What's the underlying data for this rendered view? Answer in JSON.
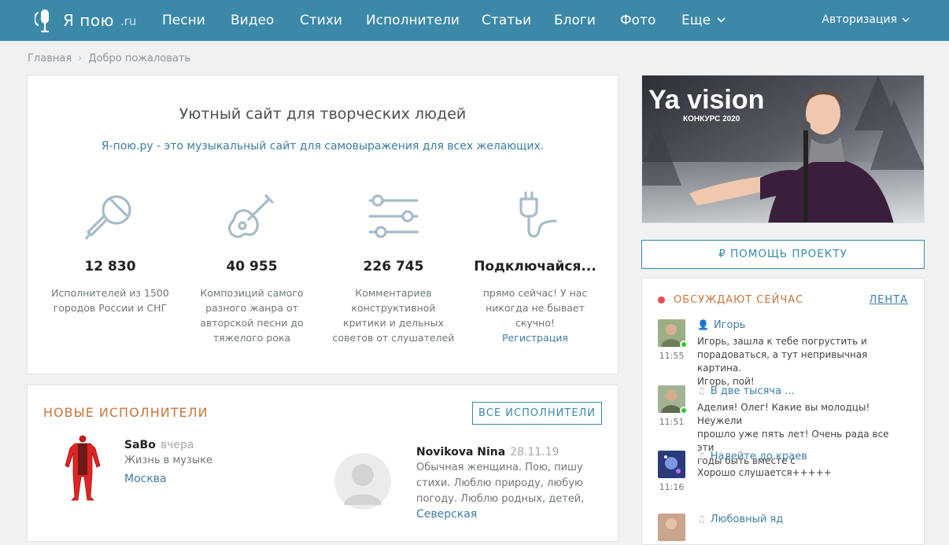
{
  "header": {
    "logo": {
      "name": "Я пою",
      "tld": ".ru"
    },
    "nav": [
      "Песни",
      "Видео",
      "Стихи",
      "Исполнители",
      "Статьи",
      "Блоги",
      "Фото",
      "Еще"
    ],
    "auth_label": "Авторизация",
    "bar_color": "#3b88a9"
  },
  "breadcrumb": {
    "home": "Главная",
    "current": "Добро пожаловать"
  },
  "intro": {
    "title": "Уютный сайт для творческих людей",
    "subtitle": "Я-пою.ру - это музыкальный сайт для самовыражения для всех желающих.",
    "features": [
      {
        "icon": "microphone-icon",
        "value": "12 830",
        "lines": [
          "Исполнителей из 1500",
          "городов России и СНГ"
        ]
      },
      {
        "icon": "guitar-icon",
        "value": "40 955",
        "lines": [
          "Композиций самого",
          "разного жанра от",
          "авторской песни до",
          "тяжелого рока"
        ]
      },
      {
        "icon": "sliders-icon",
        "value": "226 745",
        "lines": [
          "Комментариев",
          "конструктивной",
          "критики и дельных",
          "советов от слушателей"
        ]
      },
      {
        "icon": "plug-icon",
        "value": "Подключайся...",
        "lines": [
          "прямо сейчас! У нас",
          "никогда не бывает",
          "скучно!"
        ],
        "link": "Регистрация"
      }
    ]
  },
  "new_artists": {
    "title": "НОВЫЕ ИСПОЛНИТЕЛИ",
    "all_button": "ВСЕ ИСПОЛНИТЕЛИ",
    "items": [
      {
        "name": "SaBo",
        "date": "вчера",
        "bio": "Жизнь в музыке",
        "city": "Москва"
      },
      {
        "name": "Novikova Nina",
        "date": "28.11.19",
        "bio_lines": [
          "Обычная женщина. Пою, пишу",
          "стихи. Люблю природу, любую",
          "погоду. Люблю родных, детей,"
        ],
        "city": "Северская"
      }
    ]
  },
  "banner": {
    "logo_text": "Ya vision",
    "caption": "КОНКУРС 2020"
  },
  "help_button": "₽ ПОМОЩЬ ПРОЕКТУ",
  "discussion": {
    "title": "ОБСУЖДАЮТ СЕЙЧАС",
    "feed_link": "ЛЕНТА",
    "messages": [
      {
        "time": "11:55",
        "who": "Игорь",
        "glyph": "user-icon",
        "online": true,
        "lines": [
          "Игорь, зашла к тебе погрустить и",
          "порадоваться, а тут непривычная картина.",
          "Игорь, пой!"
        ]
      },
      {
        "time": "11:51",
        "who": "В две тысяча ...",
        "glyph": "music-note-icon",
        "online": true,
        "lines": [
          "Аделия! Олег! Какие вы молодцы! Неужели",
          "прошло уже пять лет! Очень рада все эти",
          "годы быть вместе с"
        ]
      },
      {
        "time": "11:16",
        "who": "Налейте до краев",
        "glyph": "music-note-icon",
        "online": false,
        "lines": [
          "Хорошо слушается+++++"
        ]
      },
      {
        "time": "",
        "who": "Любовный яд",
        "glyph": "music-note-icon",
        "online": false,
        "lines": []
      }
    ]
  }
}
